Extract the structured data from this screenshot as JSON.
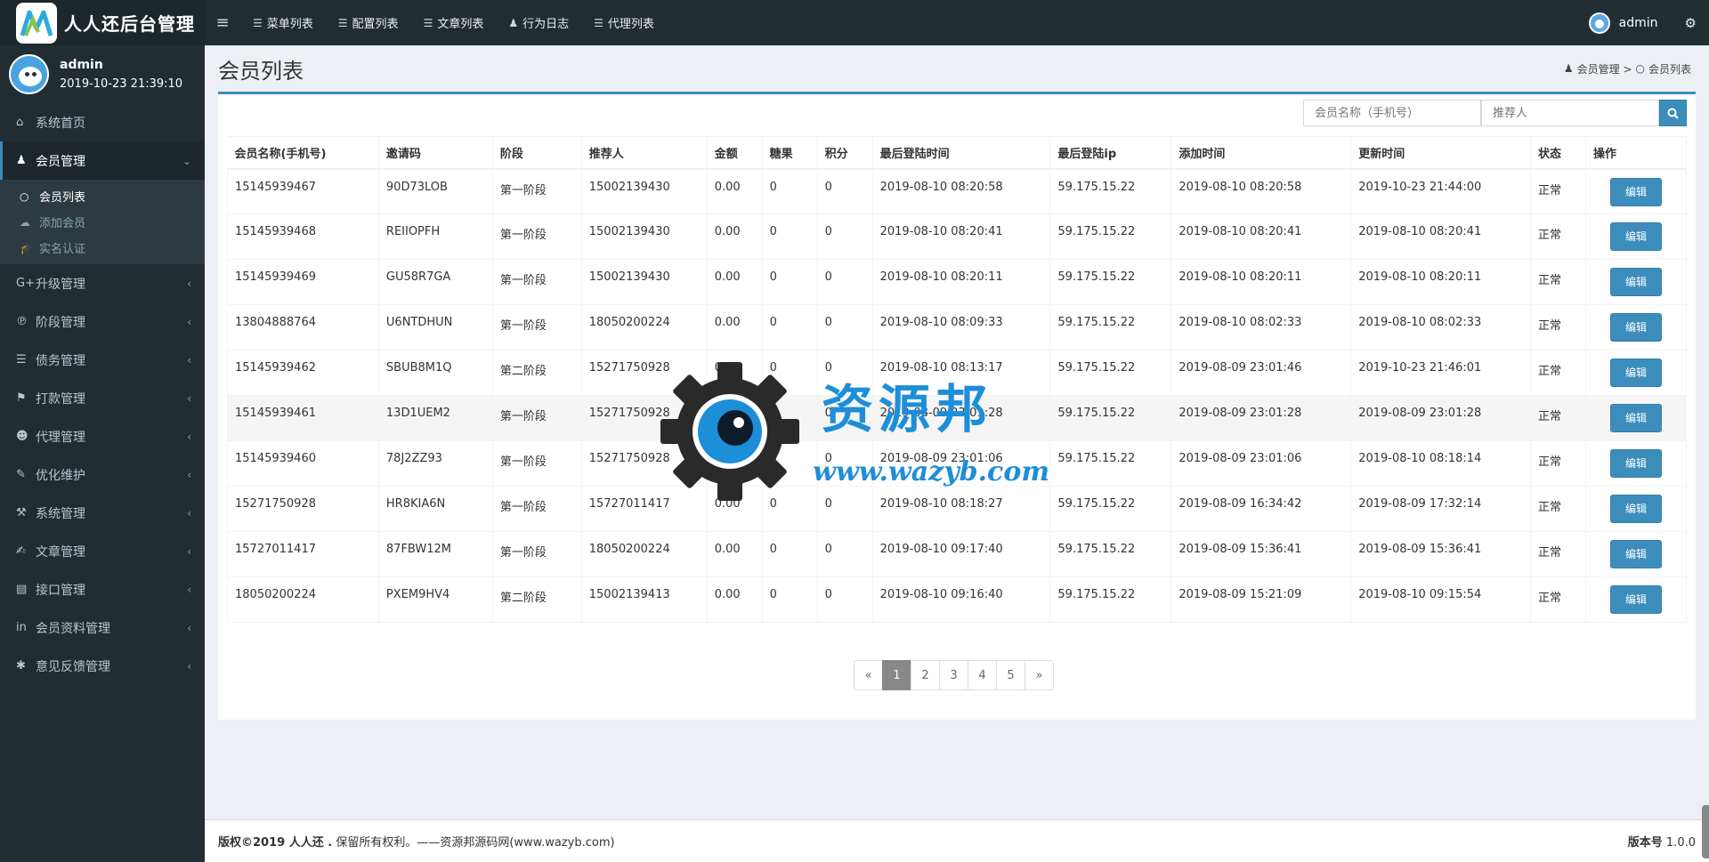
{
  "app": {
    "title": "人人还后台管理",
    "toggle": "≡"
  },
  "topnav": [
    {
      "icon": "list-icon",
      "label": "菜单列表"
    },
    {
      "icon": "list-icon",
      "label": "配置列表"
    },
    {
      "icon": "list-icon",
      "label": "文章列表"
    },
    {
      "icon": "user-icon",
      "label": "行为日志"
    },
    {
      "icon": "list-icon",
      "label": "代理列表"
    }
  ],
  "topright": {
    "username": "admin",
    "gear": "⚙"
  },
  "user_panel": {
    "name": "admin",
    "time": "2019-10-23 21:39:10"
  },
  "sidebar": {
    "items": [
      {
        "icon": "⌂",
        "label": "系统首页",
        "arrow": ""
      },
      {
        "icon": "♟",
        "label": "会员管理",
        "arrow": "⌄"
      },
      {
        "icon": "G+",
        "label": "升级管理",
        "arrow": "‹"
      },
      {
        "icon": "℗",
        "label": "阶段管理",
        "arrow": "‹"
      },
      {
        "icon": "☰",
        "label": "债务管理",
        "arrow": "‹"
      },
      {
        "icon": "⚑",
        "label": "打款管理",
        "arrow": "‹"
      },
      {
        "icon": "☻",
        "label": "代理管理",
        "arrow": "‹"
      },
      {
        "icon": "✎",
        "label": "优化维护",
        "arrow": "‹"
      },
      {
        "icon": "⚒",
        "label": "系统管理",
        "arrow": "‹"
      },
      {
        "icon": "✍",
        "label": "文章管理",
        "arrow": "‹"
      },
      {
        "icon": "▤",
        "label": "接口管理",
        "arrow": "‹"
      },
      {
        "icon": "in",
        "label": "会员资料管理",
        "arrow": "‹"
      },
      {
        "icon": "✱",
        "label": "意见反馈管理",
        "arrow": "‹"
      }
    ],
    "submenu": [
      {
        "icon": "○",
        "label": "会员列表"
      },
      {
        "icon": "☁",
        "label": "添加会员"
      },
      {
        "icon": "🎓",
        "label": "实名认证"
      }
    ]
  },
  "page": {
    "title": "会员列表",
    "breadcrumb": [
      "会员管理 >",
      "会员列表"
    ]
  },
  "search": {
    "placeholder1": "会员名称（手机号）",
    "placeholder2": "推荐人"
  },
  "table": {
    "headers": [
      "会员名称(手机号)",
      "邀请码",
      "阶段",
      "推荐人",
      "金额",
      "糖果",
      "积分",
      "最后登陆时间",
      "最后登陆ip",
      "添加时间",
      "更新时间",
      "状态",
      "操作"
    ],
    "rows": [
      [
        "15145939467",
        "90D73LOB",
        "第一阶段",
        "15002139430",
        "0.00",
        "0",
        "0",
        "2019-08-10 08:20:58",
        "59.175.15.22",
        "2019-08-10 08:20:58",
        "2019-10-23 21:44:00",
        "正常",
        "编辑"
      ],
      [
        "15145939468",
        "REIIOPFH",
        "第一阶段",
        "15002139430",
        "0.00",
        "0",
        "0",
        "2019-08-10 08:20:41",
        "59.175.15.22",
        "2019-08-10 08:20:41",
        "2019-08-10 08:20:41",
        "正常",
        "编辑"
      ],
      [
        "15145939469",
        "GU58R7GA",
        "第一阶段",
        "15002139430",
        "0.00",
        "0",
        "0",
        "2019-08-10 08:20:11",
        "59.175.15.22",
        "2019-08-10 08:20:11",
        "2019-08-10 08:20:11",
        "正常",
        "编辑"
      ],
      [
        "13804888764",
        "U6NTDHUN",
        "第一阶段",
        "18050200224",
        "0.00",
        "0",
        "0",
        "2019-08-10 08:09:33",
        "59.175.15.22",
        "2019-08-10 08:02:33",
        "2019-08-10 08:02:33",
        "正常",
        "编辑"
      ],
      [
        "15145939462",
        "SBUB8M1Q",
        "第二阶段",
        "15271750928",
        "0.00",
        "0",
        "0",
        "2019-08-10 08:13:17",
        "59.175.15.22",
        "2019-08-09 23:01:46",
        "2019-10-23 21:46:01",
        "正常",
        "编辑"
      ],
      [
        "15145939461",
        "13D1UEM2",
        "第一阶段",
        "15271750928",
        "0.00",
        "0",
        "0",
        "2019-08-09 23:01:28",
        "59.175.15.22",
        "2019-08-09 23:01:28",
        "2019-08-09 23:01:28",
        "正常",
        "编辑"
      ],
      [
        "15145939460",
        "78J2ZZ93",
        "第一阶段",
        "15271750928",
        "0.00",
        "0",
        "0",
        "2019-08-09 23:01:06",
        "59.175.15.22",
        "2019-08-09 23:01:06",
        "2019-08-10 08:18:14",
        "正常",
        "编辑"
      ],
      [
        "15271750928",
        "HR8KIA6N",
        "第一阶段",
        "15727011417",
        "0.00",
        "0",
        "0",
        "2019-08-10 08:18:27",
        "59.175.15.22",
        "2019-08-09 16:34:42",
        "2019-08-09 17:32:14",
        "正常",
        "编辑"
      ],
      [
        "15727011417",
        "87FBW12M",
        "第一阶段",
        "18050200224",
        "0.00",
        "0",
        "0",
        "2019-08-10 09:17:40",
        "59.175.15.22",
        "2019-08-09 15:36:41",
        "2019-08-09 15:36:41",
        "正常",
        "编辑"
      ],
      [
        "18050200224",
        "PXEM9HV4",
        "第二阶段",
        "15002139413",
        "0.00",
        "0",
        "0",
        "2019-08-10 09:16:40",
        "59.175.15.22",
        "2019-08-09 15:21:09",
        "2019-08-10 09:15:54",
        "正常",
        "编辑"
      ]
    ]
  },
  "pagination": {
    "prev": "«",
    "pages": [
      "1",
      "2",
      "3",
      "4",
      "5"
    ],
    "next": "»",
    "current": "1"
  },
  "footer": {
    "copyright_bold": "版权©2019 人人还 .",
    "copyright_rest": " 保留所有权利。——资源邦源码网(www.wazyb.com)",
    "version_label": "版本号",
    "version": " 1.0.0"
  },
  "watermark": {
    "text1": "资源邦",
    "text2": "www.wazyb.com"
  },
  "colors": {
    "accent": "#3c8dbc",
    "sidebar": "#222d32",
    "watermark": "#1d8ed8"
  }
}
